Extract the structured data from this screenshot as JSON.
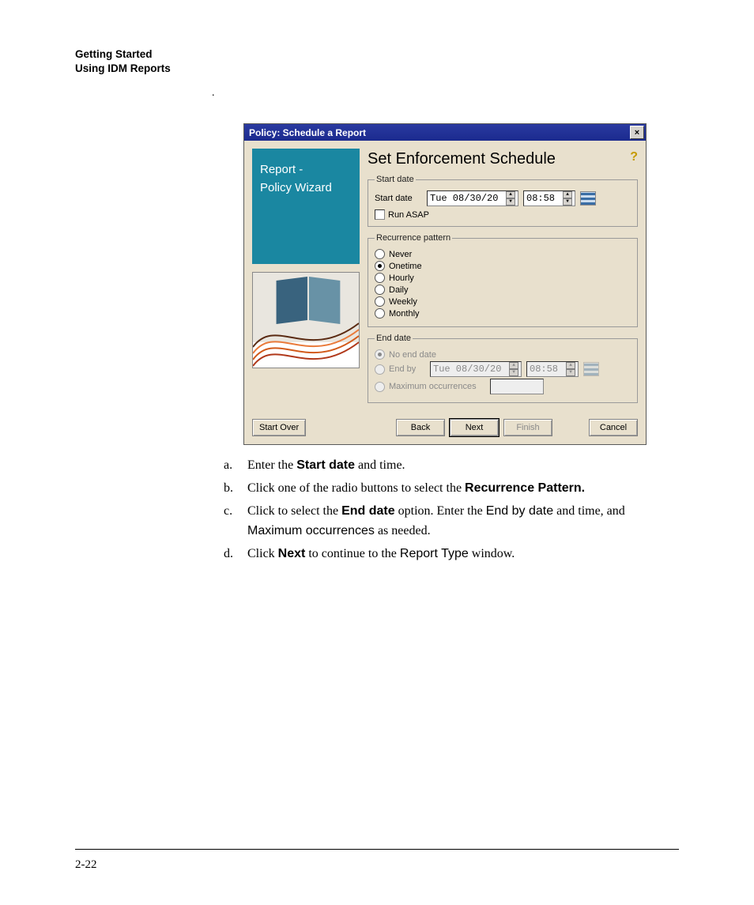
{
  "header": {
    "line1": "Getting Started",
    "line2": "Using IDM Reports"
  },
  "dot": ".",
  "dialog": {
    "title": "Policy: Schedule a Report",
    "wizard_title_1": "Report -",
    "wizard_title_2": "Policy Wizard",
    "heading": "Set Enforcement Schedule",
    "help_glyph": "?",
    "start": {
      "legend": "Start date",
      "label": "Start date",
      "date": "Tue   08/30/20",
      "time": "08:58",
      "run_asap": "Run ASAP"
    },
    "recurrence": {
      "legend": "Recurrence pattern",
      "options": [
        "Never",
        "Onetime",
        "Hourly",
        "Daily",
        "Weekly",
        "Monthly"
      ],
      "selected_index": 1
    },
    "end": {
      "legend": "End date",
      "noend": "No end date",
      "endby": "End by",
      "endby_date": "Tue   08/30/20",
      "endby_time": "08:58",
      "maxocc": "Maximum occurrences"
    },
    "buttons": {
      "start_over": "Start Over",
      "back": "Back",
      "next": "Next",
      "finish": "Finish",
      "cancel": "Cancel"
    }
  },
  "instructions": {
    "a_marker": "a.",
    "a_pre": "Enter the ",
    "a_bold": "Start date",
    "a_post": " and time.",
    "b_marker": "b.",
    "b_pre": "Click one of the radio buttons to select the ",
    "b_bold": "Recurrence Pattern.",
    "c_marker": "c.",
    "c_pre": "Click to select the ",
    "c_bold": "End date",
    "c_mid1": " option. Enter the ",
    "c_cond1": "End by date",
    "c_mid2": " and time, and ",
    "c_cond2": "Maximum occurrences",
    "c_post": " as needed.",
    "d_marker": "d.",
    "d_pre": "Click ",
    "d_bold": "Next",
    "d_mid": " to continue to the ",
    "d_cond": "Report Type",
    "d_post": " window."
  },
  "page_number": "2-22"
}
